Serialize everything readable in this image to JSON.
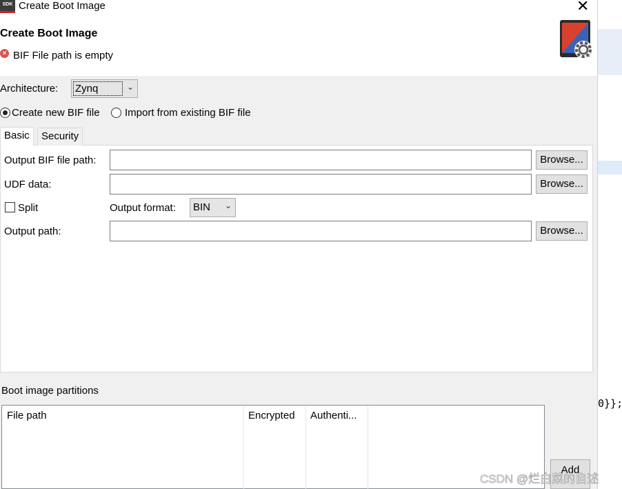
{
  "window": {
    "title": "Create Boot Image",
    "app_icon": "SDK",
    "close": "✕"
  },
  "header": {
    "title": "Create Boot Image",
    "error_message": "BIF File path is empty"
  },
  "architecture": {
    "label": "Architecture:",
    "value": "Zynq"
  },
  "bif_mode": {
    "options": [
      {
        "label": "Create new BIF file",
        "selected": true
      },
      {
        "label": "Import from existing BIF file",
        "selected": false
      }
    ]
  },
  "tabs": [
    {
      "label": "Basic",
      "active": true
    },
    {
      "label": "Security",
      "active": false
    }
  ],
  "basic": {
    "output_bif_label": "Output BIF file path:",
    "output_bif_value": "",
    "udf_label": "UDF data:",
    "udf_value": "",
    "split_label": "Split",
    "split_checked": false,
    "output_format_label": "Output format:",
    "output_format_value": "BIN",
    "output_path_label": "Output path:",
    "output_path_value": "",
    "browse_label": "Browse..."
  },
  "partitions": {
    "label": "Boot image partitions",
    "columns": [
      "File path",
      "Encrypted",
      "Authenti..."
    ],
    "rows": [],
    "add_label": "Add"
  },
  "background_code": "0}};",
  "watermark": "CSDN @烂白菜的自述",
  "colors": {
    "error": "#d9534f",
    "dialog_body": "#f0f0f0",
    "button_face": "#e1e1e1"
  }
}
